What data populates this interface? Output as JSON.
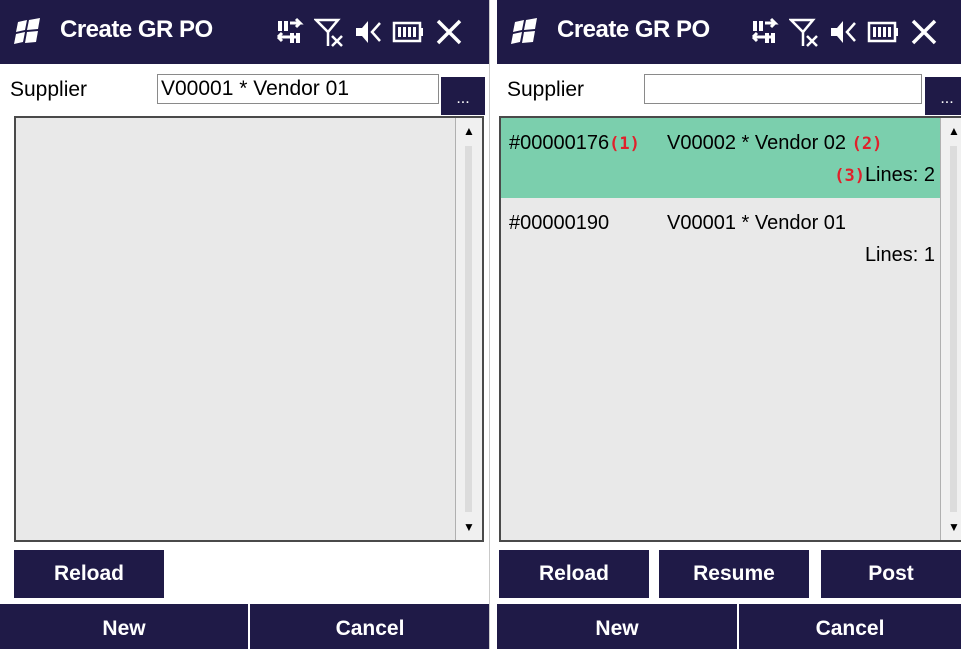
{
  "screens": {
    "left": {
      "title": "Create GR PO",
      "supplier_label": "Supplier",
      "supplier_value": "V00001 * Vendor 01",
      "browse_label": "...",
      "buttons": {
        "reload": "Reload",
        "new": "New",
        "cancel": "Cancel"
      }
    },
    "right": {
      "title": "Create GR PO",
      "supplier_label": "Supplier",
      "supplier_value": "",
      "browse_label": "...",
      "documents": [
        {
          "number": "#00000176",
          "vendor": "V00002 * Vendor 02",
          "lines": "Lines: 2",
          "marker_number": "(1)",
          "marker_vendor": "(2)",
          "marker_lines": "(3)",
          "selected": true
        },
        {
          "number": "#00000190",
          "vendor": "V00001 * Vendor 01",
          "lines": "Lines: 1",
          "selected": false
        }
      ],
      "buttons": {
        "reload": "Reload",
        "resume": "Resume",
        "post": "Post",
        "new": "New",
        "cancel": "Cancel"
      }
    }
  },
  "status_icons": [
    "sync-arrows-icon",
    "no-signal-icon",
    "speaker-muted-icon",
    "battery-icon",
    "close-icon"
  ],
  "colors": {
    "navy": "#1f1a47",
    "selected_row": "#7bcfad",
    "marker_red": "#e0212b",
    "list_bg": "#e9e9e9"
  }
}
